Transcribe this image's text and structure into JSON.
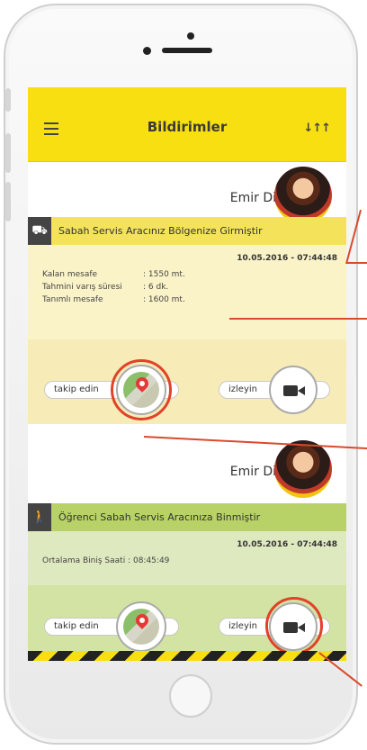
{
  "header": {
    "title": "Bildirimler"
  },
  "notifications": [
    {
      "name": "Emir Diker",
      "message": "Sabah Servis Aracınız Bölgenize Girmiştir",
      "datetime": "10.05.2016 - 07:44:48",
      "fields": [
        {
          "label": "Kalan mesafe",
          "value": ": 1550 mt."
        },
        {
          "label": "Tahmini varış süresi",
          "value": ": 6 dk."
        },
        {
          "label": "Tanımlı mesafe",
          "value": ": 1600 mt."
        }
      ],
      "follow_label": "takip edin",
      "watch_label": "izleyin",
      "icon": "bus-icon",
      "theme_color": "#f4e35a"
    },
    {
      "name": "Emir Diker",
      "message": "Öğrenci Sabah Servis Aracınıza Binmiştir",
      "datetime": "10.05.2016 - 07:44:48",
      "fields": [
        {
          "label": "Ortalama Biniş Saati",
          "value": ": 08:45:49"
        }
      ],
      "follow_label": "takip edin",
      "watch_label": "izleyin",
      "icon": "walking-person-icon",
      "theme_color": "#b8d267"
    }
  ],
  "colors": {
    "accent": "#f8df12",
    "highlight": "#e2412a"
  }
}
